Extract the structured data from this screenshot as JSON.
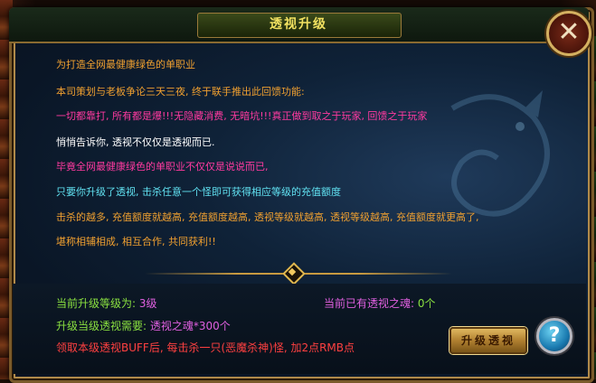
{
  "window": {
    "title": "透视升级"
  },
  "description_lines": [
    {
      "text": "为打造全网最健康绿色的单职业",
      "color": "orange"
    },
    {
      "text": "本司策划与老板争论三天三夜, 终于联手推出此回馈功能:",
      "color": "orange"
    },
    {
      "text": "一切都靠打, 所有都是爆!!!无隐藏消费, 无暗坑!!!真正做到取之于玩家, 回馈之于玩家",
      "color": "pink"
    },
    {
      "text": "悄悄告诉你, 透视不仅仅是透视而已.",
      "color": "white"
    },
    {
      "text": "毕竟全网最健康绿色的单职业不仅仅是说说而已,",
      "color": "pink"
    },
    {
      "text": "只要你升级了透视, 击杀任意一个怪即可获得相应等级的充值额度",
      "color": "cyan"
    },
    {
      "text": "击杀的越多, 充值额度就越高, 充值额度越高, 透视等级就越高, 透视等级越高, 充值额度就更高了,",
      "color": "orange"
    },
    {
      "text": "堪称相辅相成, 相互合作, 共同获利!!",
      "color": "orange"
    }
  ],
  "stats": {
    "current_level_label": "当前升级等级为: ",
    "current_level_value": "3级",
    "souls_label": "当前已有透视之魂: ",
    "souls_value": "0个",
    "required_label": "升级当级透视需要: ",
    "required_value": "透视之魂*300个",
    "buff_note": "领取本级透视BUFF后, 每击杀一只(恶魔杀神)怪, 加2点RMB点"
  },
  "buttons": {
    "upgrade_label": "升级透视",
    "help_label": "?",
    "close_label": "✕"
  },
  "colors": {
    "orange": "#f0a030",
    "pink": "#ff3aa0",
    "white": "#ffffff",
    "cyan": "#60e0f0",
    "green": "#8ae040",
    "violet": "#e060e0",
    "red": "#ff4040",
    "title": "#f0e060"
  },
  "icons": {
    "close": "close-icon",
    "help": "question-icon",
    "divider": "diamond-ornament-icon"
  }
}
